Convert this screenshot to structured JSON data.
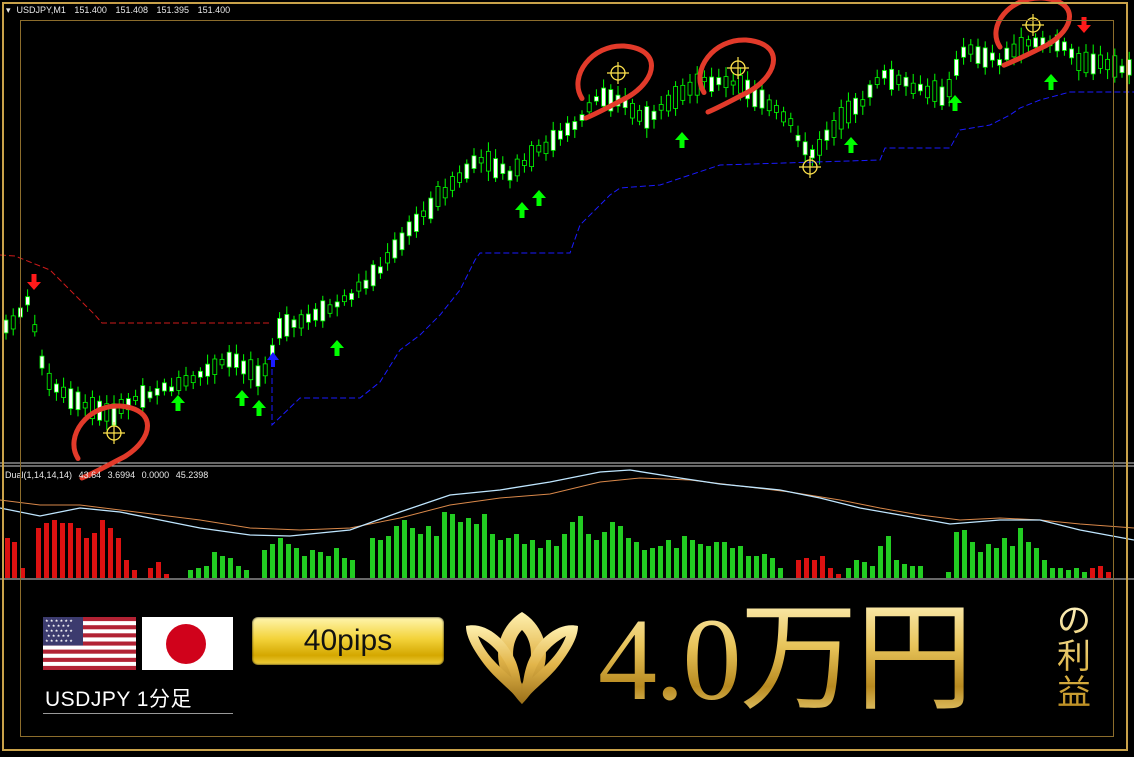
{
  "chart": {
    "symbol": "USDJPY,M1",
    "open": "151.400",
    "high": "151.408",
    "low": "151.395",
    "close": "151.400"
  },
  "indicator": {
    "name": "Dual(1,14,14,14)",
    "v1": "43.64",
    "v2": "3.6994",
    "v3": "0.0000",
    "v4": "45.2398"
  },
  "promo": {
    "pair_label": "USDJPY 1分足",
    "pips": "40pips",
    "amount": "4.0万円",
    "suffix_1": "の",
    "suffix_2": "利",
    "suffix_3": "益"
  },
  "colors": {
    "bull_candle": "#ffffff",
    "candle_wick": "#00ff00",
    "buy_arrow": "#00ff00",
    "sell_arrow": "#ff1a1a",
    "support_line": "#1a1aff",
    "resistance_line": "#cc1a1a",
    "gold": "#d9b34a",
    "hist_bull": "#22cc22",
    "hist_bear": "#dd1111",
    "line_fast": "#bfe6ff",
    "line_slow": "#d9884a"
  }
}
